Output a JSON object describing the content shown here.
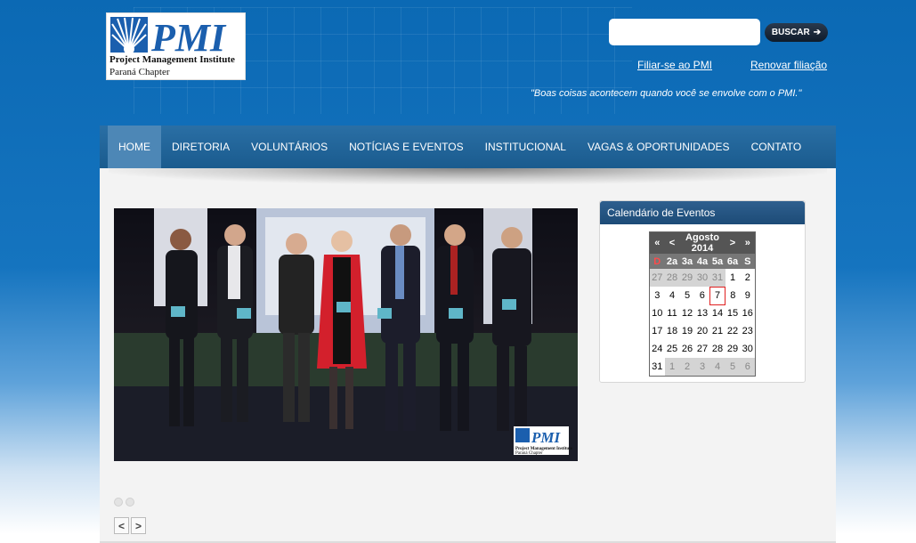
{
  "header": {
    "logo": {
      "mark_text": "PMI",
      "line1": "Project Management Institute",
      "line2": "Paraná Chapter"
    },
    "search": {
      "value": "",
      "placeholder": "",
      "button_label": "BUSCAR"
    },
    "links": {
      "join": "Filiar-se ao PMI",
      "renew": "Renovar filiação"
    },
    "tagline": "\"Boas coisas acontecem quando você se envolve com o PMI.\""
  },
  "nav": {
    "items": [
      {
        "label": "HOME",
        "active": true
      },
      {
        "label": "DIRETORIA"
      },
      {
        "label": "VOLUNTÁRIOS"
      },
      {
        "label": "NOTÍCIAS E EVENTOS"
      },
      {
        "label": "INSTITUCIONAL"
      },
      {
        "label": "VAGAS & OPORTUNIDADES"
      },
      {
        "label": "CONTATO"
      }
    ]
  },
  "calendar": {
    "title": "Calendário de Eventos",
    "prev_year": "«",
    "prev_month": "<",
    "month_label": "Agosto 2014",
    "next_month": ">",
    "next_year": "»",
    "weekdays": [
      "D",
      "2a",
      "3a",
      "4a",
      "5a",
      "6a",
      "S"
    ],
    "weeks": [
      [
        "27",
        "28",
        "29",
        "30",
        "31",
        "1",
        "2"
      ],
      [
        "3",
        "4",
        "5",
        "6",
        "7",
        "8",
        "9"
      ],
      [
        "10",
        "11",
        "12",
        "13",
        "14",
        "15",
        "16"
      ],
      [
        "17",
        "18",
        "19",
        "20",
        "21",
        "22",
        "23"
      ],
      [
        "24",
        "25",
        "26",
        "27",
        "28",
        "29",
        "30"
      ],
      [
        "31",
        "1",
        "2",
        "3",
        "4",
        "5",
        "6"
      ]
    ],
    "today": "7"
  },
  "slideshow": {
    "photo_logo_text": "PMI",
    "photo_logo_caption": "Project Management Institute",
    "photo_logo_caption2": "Paraná Chapter",
    "prev_label": "<",
    "next_label": ">",
    "slide_count": 2
  },
  "colors": {
    "header_blue": "#0b69b4",
    "nav_blue": "#1a5b8e",
    "nav_active": "#4d87b6",
    "logo_blue": "#1b5fae",
    "today_outline": "#e02020"
  }
}
